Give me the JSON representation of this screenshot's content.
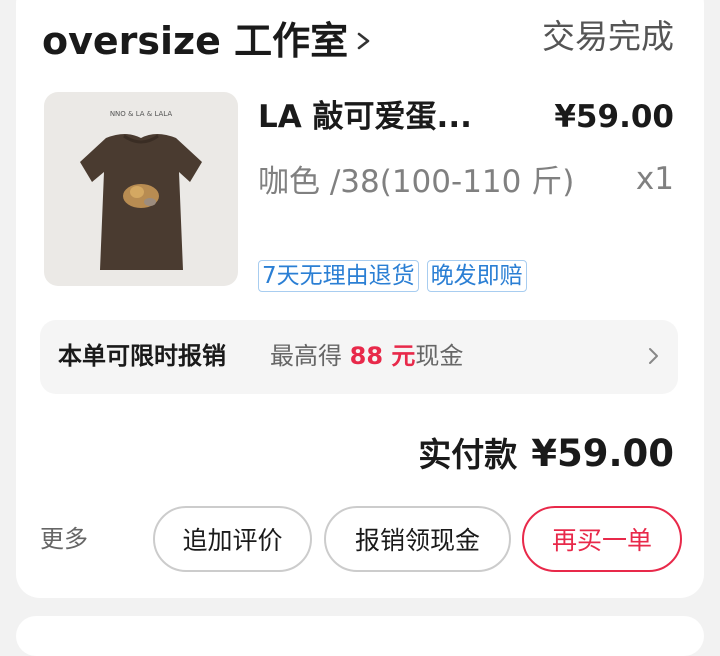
{
  "shop": {
    "name": "oversize 工作室",
    "status": "交易完成"
  },
  "product": {
    "image_caption": "NNO & LA & LALA",
    "title": "LA 敲可爱蛋...",
    "price": "¥59.00",
    "spec": "咖色 /38(100-110 斤)",
    "quantity": "x1",
    "tags": [
      "7天无理由退货",
      "晚发即赔"
    ]
  },
  "reimburse": {
    "label": "本单可限时报销",
    "desc_prefix": "最高得",
    "amount": "88 元",
    "desc_suffix": "现金"
  },
  "total": {
    "label": "实付款",
    "value": "¥59.00"
  },
  "actions": {
    "more_label": "更多",
    "review_label": "追加评价",
    "claim_label": "报销领现金",
    "rebuy_label": "再买一单"
  },
  "colors": {
    "accent_red": "#e8294a",
    "tag_blue": "#2b7fd4",
    "background": "#f2f2f2"
  },
  "icons": {
    "shop_arrow": "chevron-right-icon",
    "reimburse_arrow": "chevron-right-icon"
  }
}
